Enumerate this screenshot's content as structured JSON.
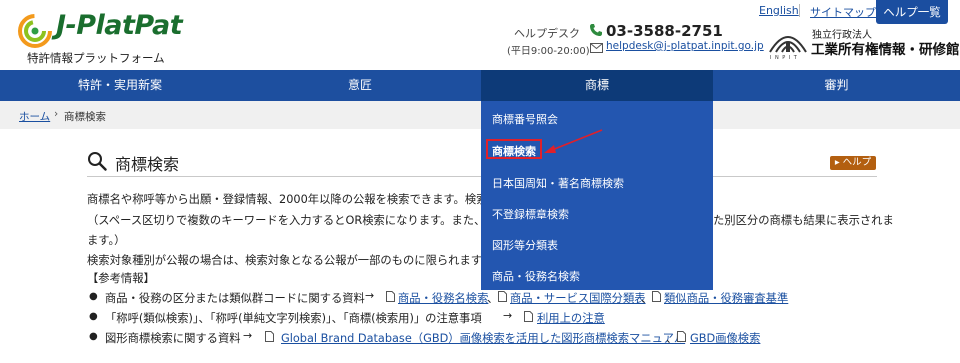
{
  "logo": {
    "name": "J-PlatPat",
    "subtitle": "特許情報プラットフォーム"
  },
  "helpdesk": {
    "label": "ヘルプデスク",
    "hours": "(平日9:00-20:00)",
    "phone": "03-3588-2751",
    "email": "helpdesk@j-platpat.inpit.go.jp"
  },
  "toplinks": {
    "english": "English",
    "sitemap": "サイトマップ",
    "help_list": "ヘルプ一覧"
  },
  "inpit": {
    "mark_text": "INPIT",
    "org_small": "独立行政法人",
    "org_big": "工業所有権情報・研修館"
  },
  "nav": [
    {
      "label": "特許・実用新案"
    },
    {
      "label": "意匠"
    },
    {
      "label": "商標"
    },
    {
      "label": "審判"
    }
  ],
  "breadcrumb": {
    "home": "ホーム",
    "sep": "›",
    "current": "商標検索"
  },
  "page": {
    "title": "商標検索",
    "help": "ヘルプ"
  },
  "body": {
    "line1": "商標名や称呼等から出願・登録情報、2000年以降の公報を検索できます。検索項",
    "line1_tail": "",
    "line2": "（スペース区切りで複数のキーワードを入力するとOR検索になります。また、区",
    "line2_tail": "た別区分の商標も結果に表示されま",
    "line3": "ます。）",
    "line4": "検索対象種別が公報の場合は、検索対象となる公報が一部のものに限られますので",
    "ref_heading": "【参考情報】",
    "bullets": [
      {
        "text": "商品・役務の区分または類似群コードに関する資料",
        "links": [
          "商品・役務名検索",
          "商品・サービス国際分類表",
          "類似商品・役務審査基準"
        ]
      },
      {
        "text": "「称呼(類似検索)」、「称呼(単純文字列検索)」、「商標(検索用)」の注意事項",
        "links": [
          "利用上の注意"
        ]
      },
      {
        "text": "図形商標検索に関する資料",
        "links": [
          "Global Brand Database（GBD）画像検索を活用した図形商標検索マニュアル",
          "GBD画像検索"
        ]
      }
    ],
    "arrow": "→",
    "bullet_char": "●",
    "sep_comma": "、"
  },
  "dropdown": {
    "items": [
      "商標番号照会",
      "商標検索",
      "日本国周知・著名商標検索",
      "不登録標章検索",
      "図形等分類表",
      "商品・役務名検索"
    ]
  },
  "colors": {
    "nav": "#1d4f9f",
    "nav_active": "#0d3a78",
    "dropdown": "#2356b0",
    "highlight": "#e0202a"
  }
}
